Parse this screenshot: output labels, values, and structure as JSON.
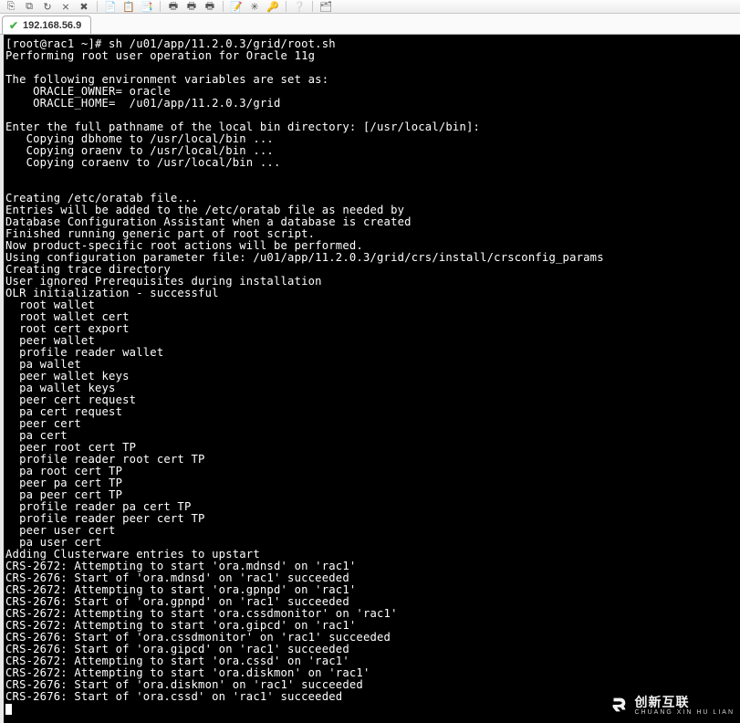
{
  "toolbar": {
    "icons": [
      "session-new-icon",
      "session-duplicate-icon",
      "session-reconnect-icon",
      "session-disconnect-icon",
      "session-close-icon",
      "sep",
      "copy-icon",
      "paste-icon",
      "paste-selection-icon",
      "sep",
      "print-icon",
      "print-setup-icon",
      "print-preview-icon",
      "sep",
      "properties-icon",
      "settings-icon",
      "key-icon",
      "sep",
      "help-icon",
      "sep",
      "toolbox-icon"
    ]
  },
  "tab": {
    "title": "192.168.56.9"
  },
  "terminal": {
    "lines": [
      "[root@rac1 ~]# sh /u01/app/11.2.0.3/grid/root.sh",
      "Performing root user operation for Oracle 11g",
      "",
      "The following environment variables are set as:",
      "    ORACLE_OWNER= oracle",
      "    ORACLE_HOME=  /u01/app/11.2.0.3/grid",
      "",
      "Enter the full pathname of the local bin directory: [/usr/local/bin]:",
      "   Copying dbhome to /usr/local/bin ...",
      "   Copying oraenv to /usr/local/bin ...",
      "   Copying coraenv to /usr/local/bin ...",
      "",
      "",
      "Creating /etc/oratab file...",
      "Entries will be added to the /etc/oratab file as needed by",
      "Database Configuration Assistant when a database is created",
      "Finished running generic part of root script.",
      "Now product-specific root actions will be performed.",
      "Using configuration parameter file: /u01/app/11.2.0.3/grid/crs/install/crsconfig_params",
      "Creating trace directory",
      "User ignored Prerequisites during installation",
      "OLR initialization - successful",
      "  root wallet",
      "  root wallet cert",
      "  root cert export",
      "  peer wallet",
      "  profile reader wallet",
      "  pa wallet",
      "  peer wallet keys",
      "  pa wallet keys",
      "  peer cert request",
      "  pa cert request",
      "  peer cert",
      "  pa cert",
      "  peer root cert TP",
      "  profile reader root cert TP",
      "  pa root cert TP",
      "  peer pa cert TP",
      "  pa peer cert TP",
      "  profile reader pa cert TP",
      "  profile reader peer cert TP",
      "  peer user cert",
      "  pa user cert",
      "Adding Clusterware entries to upstart",
      "CRS-2672: Attempting to start 'ora.mdnsd' on 'rac1'",
      "CRS-2676: Start of 'ora.mdnsd' on 'rac1' succeeded",
      "CRS-2672: Attempting to start 'ora.gpnpd' on 'rac1'",
      "CRS-2676: Start of 'ora.gpnpd' on 'rac1' succeeded",
      "CRS-2672: Attempting to start 'ora.cssdmonitor' on 'rac1'",
      "CRS-2672: Attempting to start 'ora.gipcd' on 'rac1'",
      "CRS-2676: Start of 'ora.cssdmonitor' on 'rac1' succeeded",
      "CRS-2676: Start of 'ora.gipcd' on 'rac1' succeeded",
      "CRS-2672: Attempting to start 'ora.cssd' on 'rac1'",
      "CRS-2672: Attempting to start 'ora.diskmon' on 'rac1'",
      "CRS-2676: Start of 'ora.diskmon' on 'rac1' succeeded",
      "CRS-2676: Start of 'ora.cssd' on 'rac1' succeeded"
    ]
  },
  "watermark": {
    "main": "创新互联",
    "sub": "CHUANG XIN HU LIAN"
  }
}
